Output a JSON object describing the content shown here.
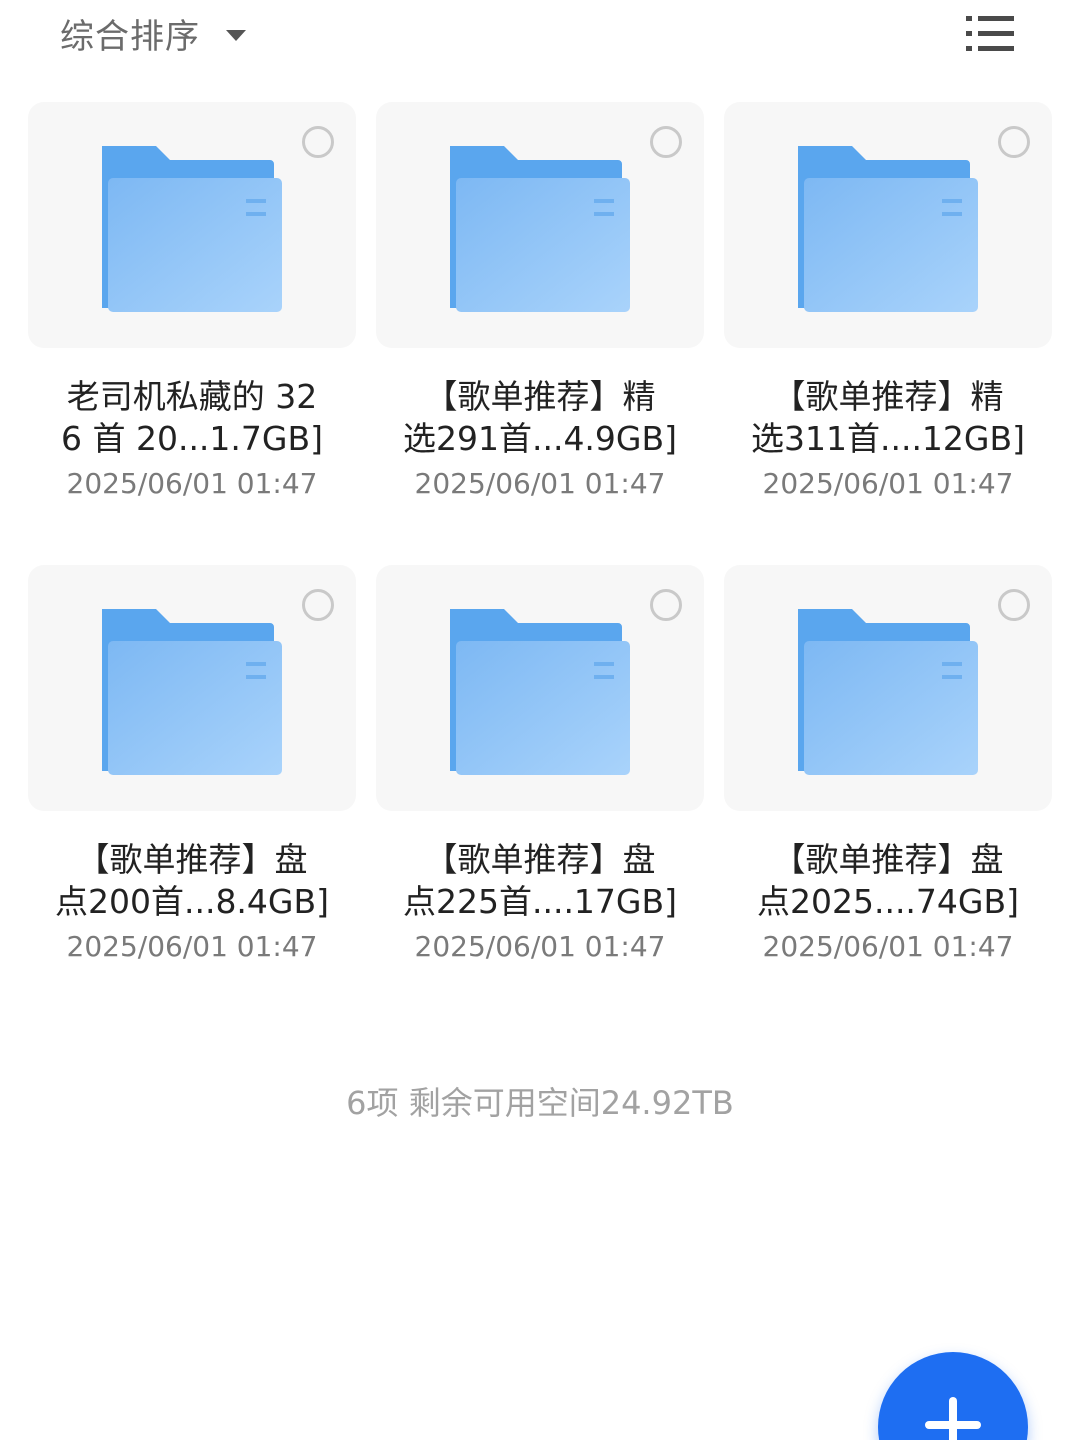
{
  "toolbar": {
    "sort_label": "综合排序",
    "sort_icon": "caret-down-icon",
    "view_toggle_icon": "list-view-icon"
  },
  "folders": [
    {
      "name_line1": "老司机私藏的 32",
      "name_line2": "6 首 20...1.7GB]",
      "date": "2025/06/01 01:47"
    },
    {
      "name_line1": "【歌单推荐】精",
      "name_line2": "选291首...4.9GB]",
      "date": "2025/06/01 01:47"
    },
    {
      "name_line1": "【歌单推荐】精",
      "name_line2": "选311首....12GB]",
      "date": "2025/06/01 01:47"
    },
    {
      "name_line1": "【歌单推荐】盘",
      "name_line2": "点200首...8.4GB]",
      "date": "2025/06/01 01:47"
    },
    {
      "name_line1": "【歌单推荐】盘",
      "name_line2": "点225首....17GB]",
      "date": "2025/06/01 01:47"
    },
    {
      "name_line1": "【歌单推荐】盘",
      "name_line2": "点2025....74GB]",
      "date": "2025/06/01 01:47"
    }
  ],
  "footer": {
    "summary": "6项 剩余可用空间24.92TB"
  },
  "fab": {
    "icon": "plus-icon"
  },
  "colors": {
    "folder_back": "#5aa6ee",
    "folder_front": "#8ec4f6",
    "fab": "#1e6ef2"
  }
}
